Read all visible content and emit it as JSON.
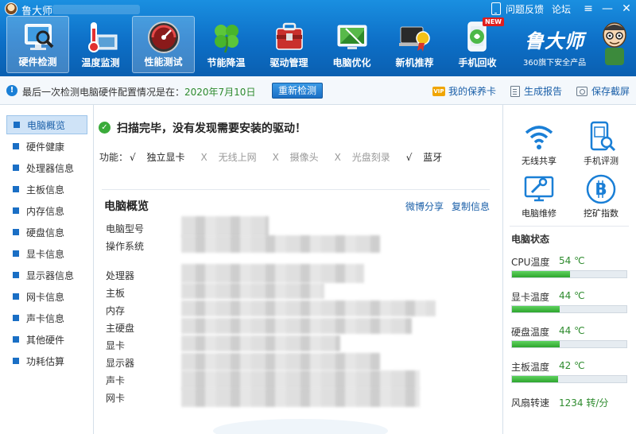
{
  "window": {
    "title": "鲁大师",
    "links": [
      "问题反馈",
      "论坛"
    ]
  },
  "nav": [
    {
      "label": "硬件检测",
      "icon": "monitor-magnifier-icon",
      "active": true
    },
    {
      "label": "温度监测",
      "icon": "thermometer-icon"
    },
    {
      "label": "性能测试",
      "icon": "speedometer-icon",
      "active": true
    },
    {
      "label": "节能降温",
      "icon": "clover-icon"
    },
    {
      "label": "驱动管理",
      "icon": "toolbox-icon"
    },
    {
      "label": "电脑优化",
      "icon": "screen-optimize-icon"
    },
    {
      "label": "新机推荐",
      "icon": "award-laptop-icon"
    },
    {
      "label": "手机回收",
      "icon": "phone-recycle-icon",
      "badge": "NEW"
    }
  ],
  "brand": {
    "name": "鲁大师",
    "subtitle": "360旗下安全产品"
  },
  "infobar": {
    "text": "最后一次检测电脑硬件配置情况是在：",
    "date": "2020年7月10日",
    "redetect": "重新检测",
    "warranty": "我的保养卡",
    "vip": "VIP",
    "report": "生成报告",
    "screenshot": "保存截屏"
  },
  "sidebar": [
    {
      "label": "电脑概览",
      "active": true
    },
    {
      "label": "硬件健康"
    },
    {
      "label": "处理器信息"
    },
    {
      "label": "主板信息"
    },
    {
      "label": "内存信息"
    },
    {
      "label": "硬盘信息"
    },
    {
      "label": "显卡信息"
    },
    {
      "label": "显示器信息"
    },
    {
      "label": "网卡信息"
    },
    {
      "label": "声卡信息"
    },
    {
      "label": "其他硬件"
    },
    {
      "label": "功耗估算"
    }
  ],
  "main": {
    "scan_message": "扫描完毕，没有发现需要安装的驱动！",
    "functions_label": "功能：",
    "functions": [
      {
        "mark": "√",
        "label": "独立显卡",
        "available": true
      },
      {
        "mark": "X",
        "label": "无线上网",
        "available": false
      },
      {
        "mark": "X",
        "label": "摄像头",
        "available": false
      },
      {
        "mark": "X",
        "label": "光盘刻录",
        "available": false
      },
      {
        "mark": "√",
        "label": "蓝牙",
        "available": true
      }
    ],
    "overview_title": "电脑概览",
    "share": "微博分享",
    "copy": "复制信息",
    "rows": [
      "电脑型号",
      "操作系统",
      "处理器",
      "主板",
      "内存",
      "主硬盘",
      "显卡",
      "显示器",
      "声卡",
      "网卡"
    ]
  },
  "tools": [
    {
      "label": "无线共享",
      "icon": "wifi-icon"
    },
    {
      "label": "手机评测",
      "icon": "phone-scan-icon"
    },
    {
      "label": "电脑维修",
      "icon": "monitor-wrench-icon"
    },
    {
      "label": "挖矿指数",
      "icon": "bitcoin-icon"
    }
  ],
  "status": {
    "title": "电脑状态",
    "items": [
      {
        "label": "CPU温度",
        "value": "54 ℃",
        "level": 0.51
      },
      {
        "label": "显卡温度",
        "value": "44 ℃",
        "level": 0.42
      },
      {
        "label": "硬盘温度",
        "value": "44 ℃",
        "level": 0.42
      },
      {
        "label": "主板温度",
        "value": "42 ℃",
        "level": 0.4
      }
    ],
    "fan_label": "风扇转速",
    "fan_value": "1234 转/分"
  },
  "colors": {
    "header": "#0d6fc7",
    "accent": "#1a6fc5",
    "ok": "#2e8b2e"
  }
}
